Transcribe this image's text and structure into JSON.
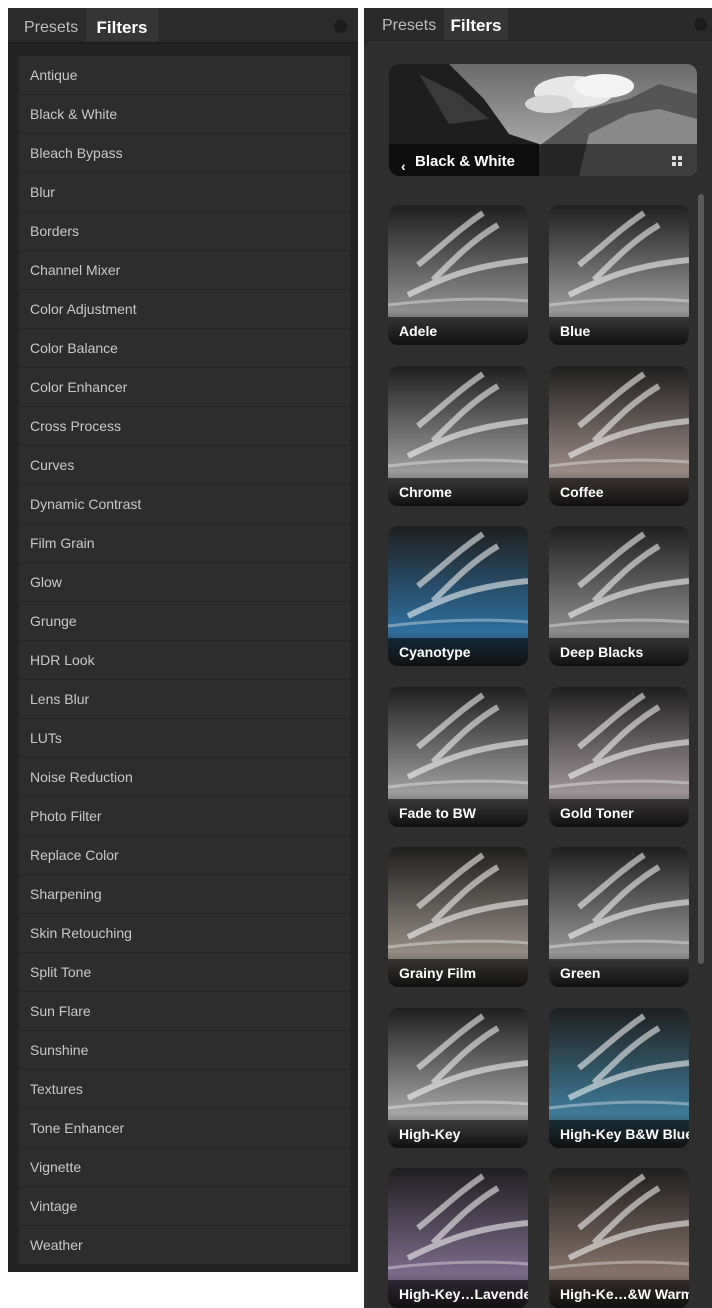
{
  "left_panel": {
    "tabs": {
      "presets": "Presets",
      "filters": "Filters"
    },
    "filters": [
      "Antique",
      "Black & White",
      "Bleach Bypass",
      "Blur",
      "Borders",
      "Channel Mixer",
      "Color Adjustment",
      "Color Balance",
      "Color Enhancer",
      "Cross Process",
      "Curves",
      "Dynamic Contrast",
      "Film Grain",
      "Glow",
      "Grunge",
      "HDR Look",
      "Lens Blur",
      "LUTs",
      "Noise Reduction",
      "Photo Filter",
      "Replace Color",
      "Sharpening",
      "Skin Retouching",
      "Split Tone",
      "Sun Flare",
      "Sunshine",
      "Textures",
      "Tone Enhancer",
      "Vignette",
      "Vintage",
      "Weather"
    ]
  },
  "right_panel": {
    "tabs": {
      "presets": "Presets",
      "filters": "Filters"
    },
    "category": {
      "back_icon": "‹",
      "title": "Black & White",
      "grid_icon": "grid-view-icon"
    },
    "presets": [
      {
        "name": "Adele",
        "tint": "#8f8f8f"
      },
      {
        "name": "Blue",
        "tint": "#9a9a9a"
      },
      {
        "name": "Chrome",
        "tint": "#9c9c9c"
      },
      {
        "name": "Coffee",
        "tint": "#9a8a86"
      },
      {
        "name": "Cyanotype",
        "tint": "#2f6f9e"
      },
      {
        "name": "Deep Blacks",
        "tint": "#8c8c8c"
      },
      {
        "name": "Fade to BW",
        "tint": "#9e9e9e"
      },
      {
        "name": "Gold Toner",
        "tint": "#9d9497"
      },
      {
        "name": "Grainy Film",
        "tint": "#938c84"
      },
      {
        "name": "Green",
        "tint": "#969696"
      },
      {
        "name": "High-Key",
        "tint": "#a4a4a4"
      },
      {
        "name": "High-Key B&W Blue",
        "tint": "#3f7a96"
      },
      {
        "name": "High-Key…Lavende",
        "tint": "#7c6a8c"
      },
      {
        "name": "High-Ke…&W Warm",
        "tint": "#86726a"
      }
    ]
  }
}
